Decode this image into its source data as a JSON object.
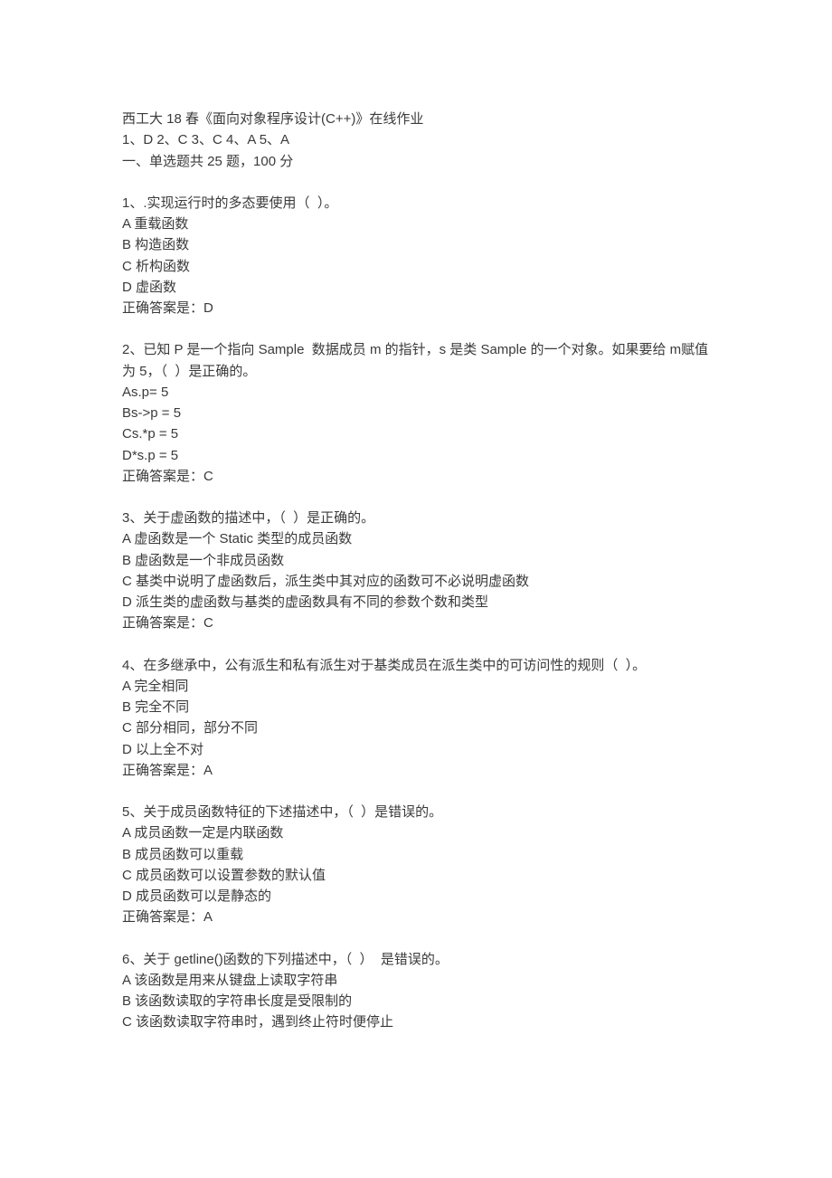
{
  "header": {
    "title": "西工大 18 春《面向对象程序设计(C++)》在线作业",
    "summary": "1、D 2、C 3、C 4、A 5、A",
    "section": "一、单选题共 25 题，100 分"
  },
  "questions": [
    {
      "q": "1、.实现运行时的多态要使用（  ）。",
      "opts": [
        "A 重载函数",
        "B 构造函数",
        "C 析构函数",
        "D 虚函数"
      ],
      "ans": "正确答案是：D"
    },
    {
      "q": "2、已知 P 是一个指向 Sample  数据成员 m 的指针，s 是类 Sample 的一个对象。如果要给 m赋值为 5，（  ）是正确的。",
      "opts": [
        "As.p= 5",
        "Bs->p = 5",
        "Cs.*p = 5",
        "D*s.p = 5"
      ],
      "ans": "正确答案是：C"
    },
    {
      "q": "3、关于虚函数的描述中，（  ）是正确的。",
      "opts": [
        "A 虚函数是一个 Static 类型的成员函数",
        "B 虚函数是一个非成员函数",
        "C 基类中说明了虚函数后，派生类中其对应的函数可不必说明虚函数",
        "D 派生类的虚函数与基类的虚函数具有不同的参数个数和类型"
      ],
      "ans": "正确答案是：C"
    },
    {
      "q": "4、在多继承中，公有派生和私有派生对于基类成员在派生类中的可访问性的规则（  ）。",
      "opts": [
        "A 完全相同",
        "B 完全不同",
        "C 部分相同，部分不同",
        "D 以上全不对"
      ],
      "ans": "正确答案是：A"
    },
    {
      "q": "5、关于成员函数特征的下述描述中，（  ）是错误的。",
      "opts": [
        "A 成员函数一定是内联函数",
        "B 成员函数可以重载",
        "C 成员函数可以设置参数的默认值",
        "D 成员函数可以是静态的"
      ],
      "ans": "正确答案是：A"
    },
    {
      "q": "6、关于 getline()函数的下列描述中，（  ）  是错误的。",
      "opts": [
        "A 该函数是用来从键盘上读取字符串",
        "B 该函数读取的字符串长度是受限制的",
        "C 该函数读取字符串时，遇到终止符时便停止"
      ],
      "ans": ""
    }
  ]
}
